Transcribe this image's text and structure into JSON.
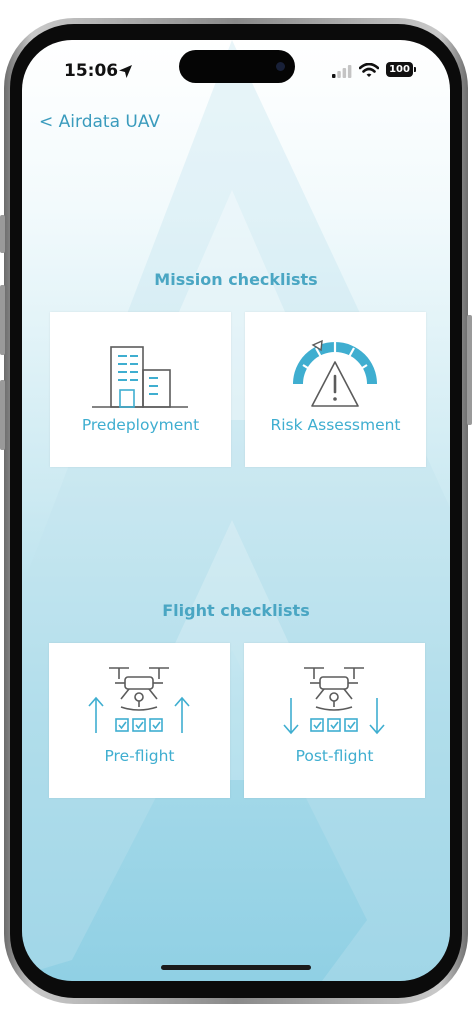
{
  "status_bar": {
    "time": "15:06",
    "battery": "100"
  },
  "nav": {
    "back_label": "< Airdata UAV"
  },
  "sections": {
    "mission": {
      "title": "Mission checklists",
      "cards": [
        {
          "label": "Predeployment",
          "icon": "building-icon"
        },
        {
          "label": "Risk Assessment",
          "icon": "risk-gauge-icon"
        }
      ]
    },
    "flight": {
      "title": "Flight checklists",
      "cards": [
        {
          "label": "Pre-flight",
          "icon": "drone-up-icon"
        },
        {
          "label": "Post-flight",
          "icon": "drone-down-icon"
        }
      ]
    }
  },
  "colors": {
    "accent": "#3faed0",
    "title": "#4aa6c3",
    "icon_gray": "#5b5b5b"
  }
}
